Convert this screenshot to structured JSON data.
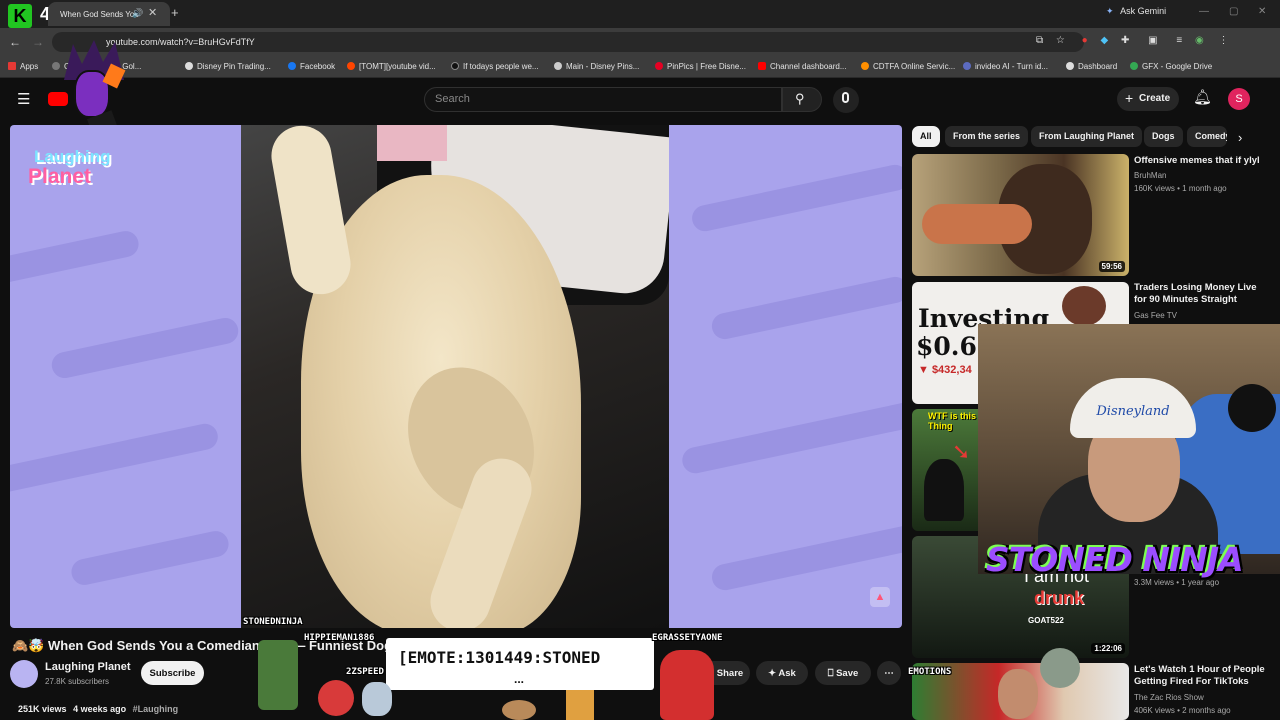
{
  "browser": {
    "tab_title": "When God Sends You",
    "ask_gemini": "Ask Gemini",
    "url": "youtube.com/watch?v=BruHGvFdTfY",
    "bookmarks": [
      "Apps",
      "Comprehensive Gol...",
      "Disney Pin Trading...",
      "Facebook",
      "[TOMT][youtube vid...",
      "If todays people we...",
      "Main - Disney Pins...",
      "PinPics | Free Disne...",
      "Channel dashboard...",
      "CDTFA Online Servic...",
      "invideo AI - Turn id...",
      "Dashboard",
      "GFX - Google Drive"
    ]
  },
  "header": {
    "search_placeholder": "Search",
    "create_label": "Create",
    "avatar_letter": "S"
  },
  "player": {
    "brand_line1": "Laughing",
    "brand_line2": "Planet",
    "watermark": "STONEDNINJA"
  },
  "video": {
    "title": "🙈🤯 When God Sends You a Comedian Dog — Funniest Dog",
    "channel": "Laughing Planet",
    "subscribers": "27.8K subscribers",
    "subscribe_label": "Subscribe",
    "share_label": "Share",
    "ask_label": "Ask",
    "save_label": "Save",
    "views": "251K views",
    "age": "4 weeks ago",
    "hashtag": "#Laughing"
  },
  "chips": [
    "All",
    "From the series",
    "From Laughing Planet",
    "Dogs",
    "Comedy"
  ],
  "recommendations": [
    {
      "title": "Offensive memes that if ylyl",
      "channel": "BruhMan",
      "meta": "160K views • 1 month ago",
      "duration": "59:56",
      "color": "#8a7a55"
    },
    {
      "title": "Traders Losing Money Live for 90 Minutes Straight",
      "channel": "Gas Fee TV",
      "meta": "",
      "duration": "",
      "color": "#e8e6e2"
    },
    {
      "title": "",
      "channel": "",
      "meta": "",
      "duration": "",
      "color": "#2d5a2a"
    },
    {
      "title": "",
      "channel": "",
      "meta": "3.3M views • 1 year ago",
      "duration": "1:22:06",
      "color": "#233322"
    },
    {
      "title": "Let's Watch 1 Hour of People Getting Fired For TikToks",
      "channel": "The Zac Rios Show",
      "meta": "406K views • 2 months ago",
      "duration": "",
      "color": "#c33"
    }
  ],
  "thumb_text": {
    "investing": "Investing",
    "price": "$0.61",
    "change": "▼ $432,34",
    "wtf": "WTF is this Thing",
    "not": "I am not",
    "drunk": "drunk",
    "tag": "GOAT522"
  },
  "overlay": {
    "streamer": "STONED NINJA",
    "emote": "[EMOTE:1301449:STONED",
    "emote_dots": "...",
    "chat1": "HIPPIEMAN1886",
    "chat2": "2ZSPEED",
    "chat3": "EGRASSETYAONE",
    "chat4": "EMOTIONS",
    "badge": "4"
  }
}
